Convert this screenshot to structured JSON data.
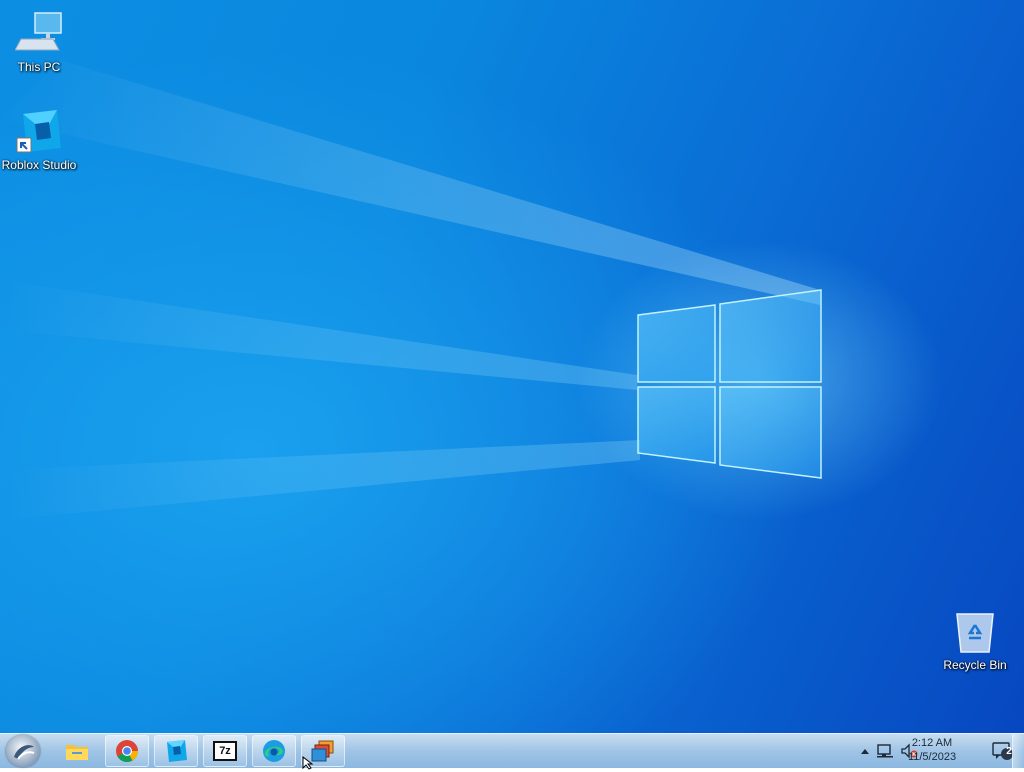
{
  "desktop": {
    "icons": [
      {
        "label": "This PC",
        "icon": "computer-icon"
      },
      {
        "label": "Roblox Studio",
        "icon": "roblox-studio-icon"
      },
      {
        "label": "Recycle Bin",
        "icon": "recycle-bin-icon"
      }
    ],
    "wallpaper": {
      "accent": "#0a86de",
      "deep": "#0747c0",
      "glow": "#8fe0ff"
    }
  },
  "taskbar": {
    "start_button": {
      "icon": "start-orb-icon"
    },
    "pinned": [
      {
        "icon": "file-explorer-icon"
      },
      {
        "icon": "chrome-icon"
      },
      {
        "icon": "roblox-studio-icon"
      },
      {
        "icon": "7zip-icon",
        "text": "7z"
      },
      {
        "icon": "edge-icon"
      },
      {
        "icon": "app-windows-icon"
      }
    ],
    "tray": {
      "time": "2:12 AM",
      "date": "11/5/2023",
      "notification_count": "2",
      "icons": [
        "chevron-up-icon",
        "network-icon",
        "volume-muted-icon",
        "action-center-icon"
      ]
    }
  }
}
